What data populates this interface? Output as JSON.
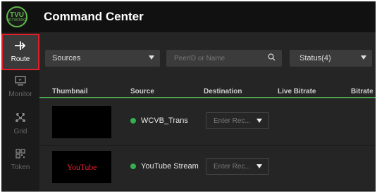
{
  "header": {
    "logo_text": "TVU",
    "logo_subtext": "NETWORKS",
    "title": "Command Center"
  },
  "sidebar": {
    "items": [
      {
        "label": "Route",
        "icon": "route-icon",
        "active": true
      },
      {
        "label": "Monitor",
        "icon": "monitor-icon",
        "active": false
      },
      {
        "label": "Grid",
        "icon": "grid-icon",
        "active": false
      },
      {
        "label": "Token",
        "icon": "token-icon",
        "active": false
      }
    ]
  },
  "filters": {
    "sources_label": "Sources",
    "search_placeholder": "PeerID or Name",
    "status_label": "Status(4)"
  },
  "table": {
    "columns": [
      "Thumbnail",
      "Source",
      "Destination",
      "Live Bitrate",
      "Bitrate"
    ],
    "rows": [
      {
        "thumbnail": "",
        "source": "WCVB_Trans",
        "destination_placeholder": "Enter Rec..."
      },
      {
        "thumbnail": "YouTube",
        "source": "YouTube Stream",
        "destination_placeholder": "Enter Rec..."
      }
    ]
  },
  "colors": {
    "accent_green": "#4aa64a",
    "status_online": "#33b04f",
    "highlight_red": "#e3202a"
  }
}
